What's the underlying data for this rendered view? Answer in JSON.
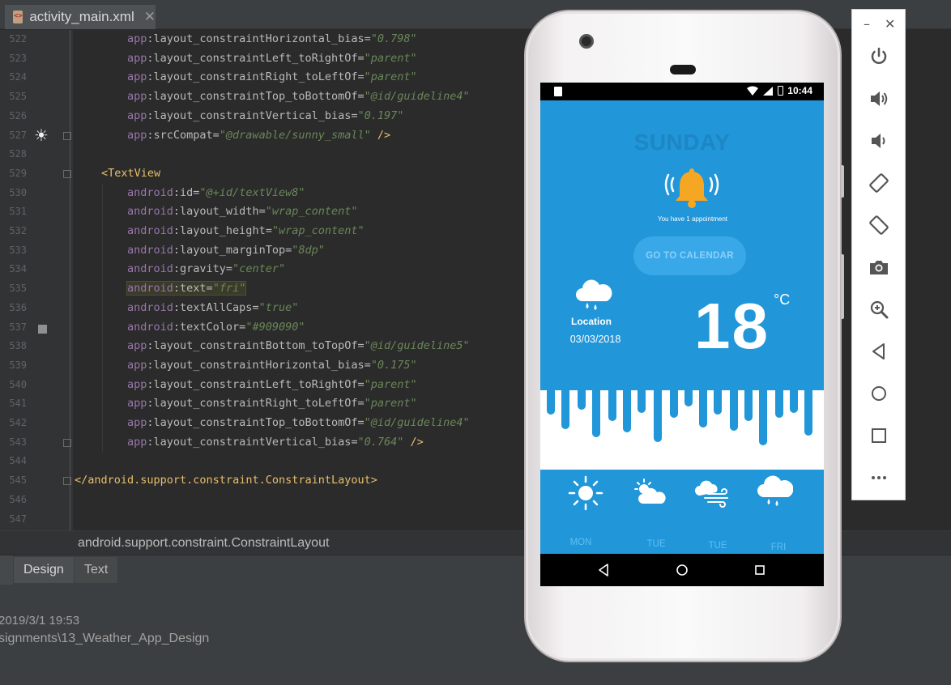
{
  "ide": {
    "tab_title": "activity_main.xml",
    "tab_close": "✕",
    "lines": [
      {
        "num": "522",
        "ns": "app",
        "attr": ":layout_constraintHorizontal_bias=",
        "val": "\"0.798\"",
        "tail": ""
      },
      {
        "num": "523",
        "ns": "app",
        "attr": ":layout_constraintLeft_toRightOf=",
        "val": "\"parent\"",
        "tail": ""
      },
      {
        "num": "524",
        "ns": "app",
        "attr": ":layout_constraintRight_toLeftOf=",
        "val": "\"parent\"",
        "tail": ""
      },
      {
        "num": "525",
        "ns": "app",
        "attr": ":layout_constraintTop_toBottomOf=",
        "val": "\"@id/guideline4\"",
        "tail": ""
      },
      {
        "num": "526",
        "ns": "app",
        "attr": ":layout_constraintVertical_bias=",
        "val": "\"0.197\"",
        "tail": ""
      },
      {
        "num": "527",
        "ns": "app",
        "attr": ":srcCompat=",
        "val": "\"@drawable/sunny_small\"",
        "tail": " />"
      },
      {
        "num": "528",
        "ns": "",
        "attr": "",
        "val": "",
        "tail": ""
      },
      {
        "num": "529",
        "ns": "",
        "attr": "",
        "val": "",
        "tail": "",
        "tag": "<TextView"
      },
      {
        "num": "530",
        "ns": "android",
        "attr": ":id=",
        "val": "\"@+id/textView8\"",
        "tail": ""
      },
      {
        "num": "531",
        "ns": "android",
        "attr": ":layout_width=",
        "val": "\"wrap_content\"",
        "tail": ""
      },
      {
        "num": "532",
        "ns": "android",
        "attr": ":layout_height=",
        "val": "\"wrap_content\"",
        "tail": ""
      },
      {
        "num": "533",
        "ns": "android",
        "attr": ":layout_marginTop=",
        "val": "\"8dp\"",
        "tail": ""
      },
      {
        "num": "534",
        "ns": "android",
        "attr": ":gravity=",
        "val": "\"center\"",
        "tail": ""
      },
      {
        "num": "535",
        "ns": "android",
        "attr": ":text=",
        "val": "\"fri\"",
        "tail": "",
        "highlight": true
      },
      {
        "num": "536",
        "ns": "android",
        "attr": ":textAllCaps=",
        "val": "\"true\"",
        "tail": ""
      },
      {
        "num": "537",
        "ns": "android",
        "attr": ":textColor=",
        "val": "\"#909090\"",
        "tail": ""
      },
      {
        "num": "538",
        "ns": "app",
        "attr": ":layout_constraintBottom_toTopOf=",
        "val": "\"@id/guideline5\"",
        "tail": ""
      },
      {
        "num": "539",
        "ns": "app",
        "attr": ":layout_constraintHorizontal_bias=",
        "val": "\"0.175\"",
        "tail": ""
      },
      {
        "num": "540",
        "ns": "app",
        "attr": ":layout_constraintLeft_toRightOf=",
        "val": "\"parent\"",
        "tail": ""
      },
      {
        "num": "541",
        "ns": "app",
        "attr": ":layout_constraintRight_toLeftOf=",
        "val": "\"parent\"",
        "tail": ""
      },
      {
        "num": "542",
        "ns": "app",
        "attr": ":layout_constraintTop_toBottomOf=",
        "val": "\"@id/guideline4\"",
        "tail": ""
      },
      {
        "num": "543",
        "ns": "app",
        "attr": ":layout_constraintVertical_bias=",
        "val": "\"0.764\"",
        "tail": " />"
      },
      {
        "num": "544",
        "ns": "",
        "attr": "",
        "val": "",
        "tail": ""
      },
      {
        "num": "545",
        "ns": "",
        "attr": "",
        "val": "",
        "tail": "",
        "tag": "</android.support.constraint.ConstraintLayout>"
      },
      {
        "num": "546",
        "ns": "",
        "attr": "",
        "val": "",
        "tail": ""
      },
      {
        "num": "547",
        "ns": "",
        "attr": "",
        "val": "",
        "tail": ""
      }
    ],
    "breadcrumb": "android.support.constraint.ConstraintLayout",
    "mode_tabs": {
      "design": "Design",
      "text": "Text"
    },
    "status_time": "2019/3/1 19:53",
    "status_path": "signments\\13_Weather_App_Design"
  },
  "emulator_toolbar": {
    "minimize": "–",
    "close": "✕",
    "buttons": [
      "power-icon",
      "volume-up-icon",
      "volume-down-icon",
      "rotate-left-icon",
      "rotate-right-icon",
      "camera-icon",
      "zoom-icon",
      "back-icon",
      "home-icon",
      "overview-icon",
      "more-icon"
    ]
  },
  "app": {
    "status_time": "10:44",
    "day": "SUNDAY",
    "appointment": "You have 1 appointment",
    "calendar_button": "GO TO CALENDAR",
    "location": "Location",
    "date": "03/03/2018",
    "temperature": "18",
    "unit": "°C",
    "forecast": [
      {
        "day": "MON",
        "icon": "sunny-icon"
      },
      {
        "day": "TUE",
        "icon": "partly-cloudy-icon"
      },
      {
        "day": "TUE",
        "icon": "windy-icon"
      },
      {
        "day": "FRI",
        "icon": "rain-icon"
      }
    ],
    "colors": {
      "screen_bg": "#2196d8",
      "button_bg": "#39a8e8",
      "forecast_label": "#5dc0f5",
      "bell": "#f5a623"
    }
  }
}
